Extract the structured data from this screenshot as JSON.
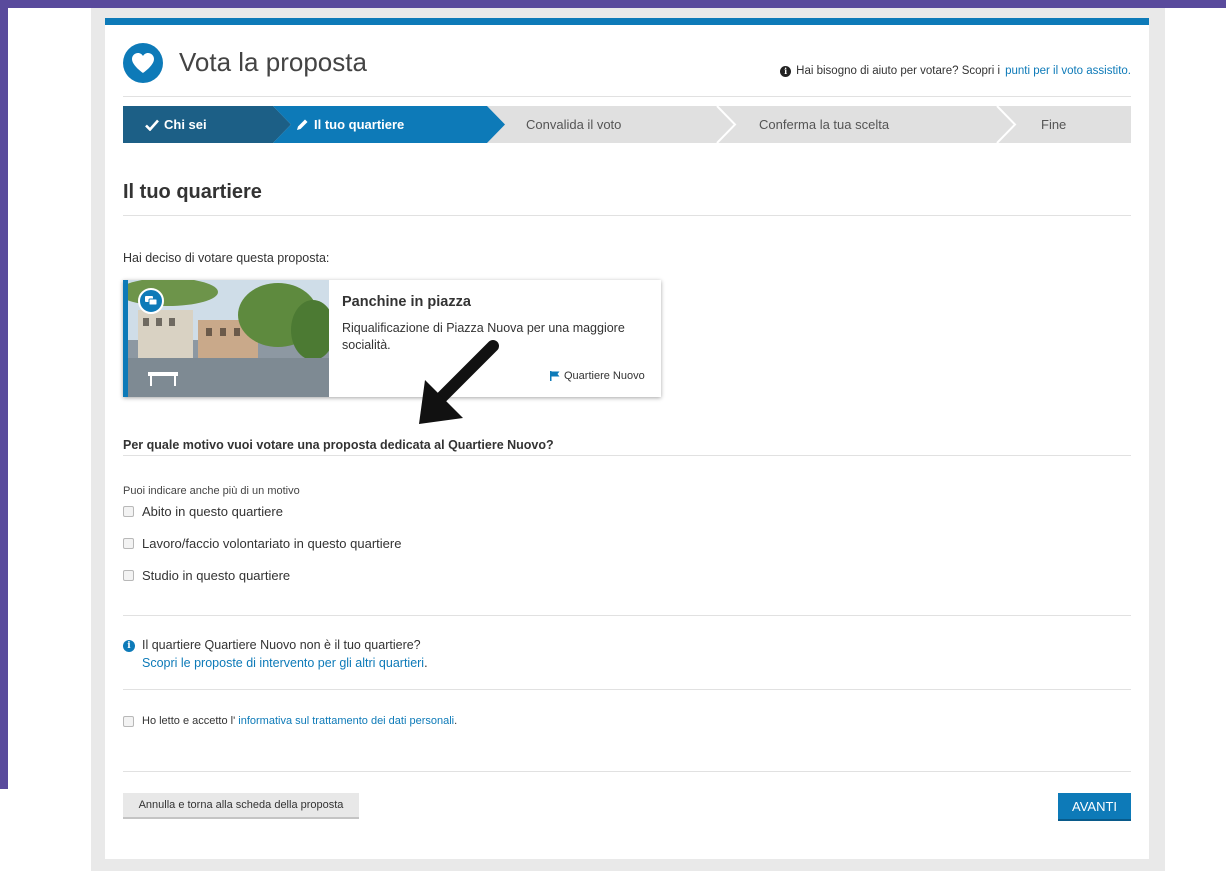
{
  "colors": {
    "accent": "#0d7ab8",
    "step_done": "#1c5f86",
    "step_inactive": "#e0e0e0",
    "frame": "#594a9c"
  },
  "header": {
    "icon": "heart-icon",
    "title": "Vota la proposta",
    "help_text": "Hai bisogno di aiuto per votare? Scopri i",
    "help_link": "punti per il voto assistito."
  },
  "steps": [
    {
      "label": "Chi sei",
      "icon": "check-icon",
      "state": "done"
    },
    {
      "label": "Il tuo quartiere",
      "icon": "pencil-icon",
      "state": "active"
    },
    {
      "label": "Convalida il voto",
      "state": "inactive"
    },
    {
      "label": "Conferma la tua scelta",
      "state": "inactive"
    },
    {
      "label": "Fine",
      "state": "inactive"
    }
  ],
  "main": {
    "heading": "Il tuo quartiere",
    "intro": "Hai deciso di votare questa proposta:",
    "proposal": {
      "title": "Panchine in piazza",
      "description": "Riqualificazione di Piazza Nuova per una maggiore socialità.",
      "district": "Quartiere Nuovo",
      "badge_icon": "chat-bubbles-icon"
    },
    "question": "Per quale motivo vuoi votare una proposta dedicata al Quartiere Nuovo?",
    "hint": "Puoi indicare anche più di un motivo",
    "options": [
      {
        "label": "Abito in questo quartiere",
        "checked": false
      },
      {
        "label": "Lavoro/faccio volontariato in questo quartiere",
        "checked": false
      },
      {
        "label": "Studio in questo quartiere",
        "checked": false
      }
    ],
    "note": {
      "text": "Il quartiere Quartiere Nuovo non è il tuo quartiere?",
      "link": "Scopri le proposte di intervento per gli altri quartieri"
    },
    "privacy": {
      "text": "Ho letto e accetto l'",
      "link": "informativa sul trattamento dei dati personali",
      "checked": false
    }
  },
  "actions": {
    "cancel_label": "Annulla e torna alla scheda della proposta",
    "next_label": "AVANTI"
  }
}
